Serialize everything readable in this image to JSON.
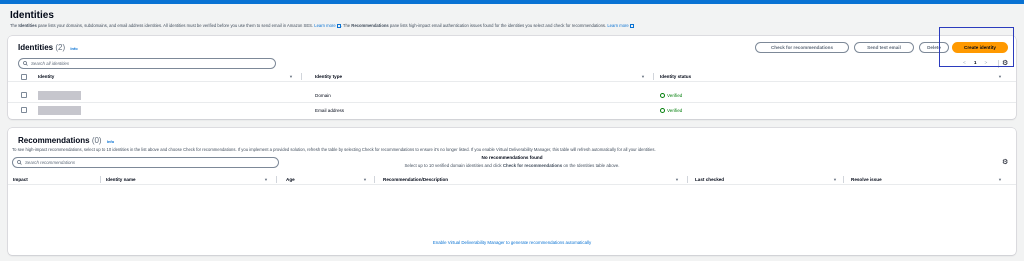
{
  "page": {
    "title": "Identities",
    "description_pre": "The ",
    "description_bold1": "Identities",
    "description_mid": " pane lists your domains, subdomains, and email address identities. All identities must be verified before you use them to send email in Amazon SES. ",
    "learn_more1": "Learn more",
    "description_mid2": ". The ",
    "description_bold2": "Recommendations",
    "description_post": " pane lists high-impact email authentication issues found for the identities you select and check for recommendations. ",
    "learn_more2": "Learn more"
  },
  "identities": {
    "title": "Identities",
    "count": "(2)",
    "info": "Info",
    "buttons": {
      "check": "Check for recommendations",
      "send_test": "Send test email",
      "delete": "Delete",
      "create": "Create identity"
    },
    "search_placeholder": "Search all identities",
    "columns": [
      "Identity",
      "Identity type",
      "Identity status"
    ],
    "rows": [
      {
        "type": "Domain",
        "status": "Verified"
      },
      {
        "type": "Email address",
        "status": "Verified"
      }
    ],
    "pagination": {
      "prev": "<",
      "page": "1",
      "next": ">"
    }
  },
  "recommendations": {
    "title": "Recommendations",
    "count": "(0)",
    "info": "Info",
    "description": "To see high-impact recommendations, select up to 10 identities in the list above and choose Check for recommendations. If you implement a provided solution, refresh the table by selecting Check for recommendations to ensure it's no longer listed. If you enable Virtual Deliverability Manager, this table will refresh automatically for all your identities.",
    "search_placeholder": "Search recommendations",
    "columns": [
      "Impact",
      "Identity name",
      "Age",
      "Recommendation/Description",
      "Last checked",
      "Resolve issue"
    ],
    "empty_title": "No recommendations found",
    "empty_sub_pre": "Select up to 10 verified domain identities and click ",
    "empty_sub_bold": "Check for recommendations",
    "empty_sub_post": " on the Identities table above.",
    "enable_link": "Enable Virtual Deliverability Manager to generate recommendations automatically"
  },
  "colors": {
    "accent": "#0972d3",
    "primary_button": "#ff9900",
    "success": "#037f0c",
    "highlight": "#2b3bbd"
  }
}
